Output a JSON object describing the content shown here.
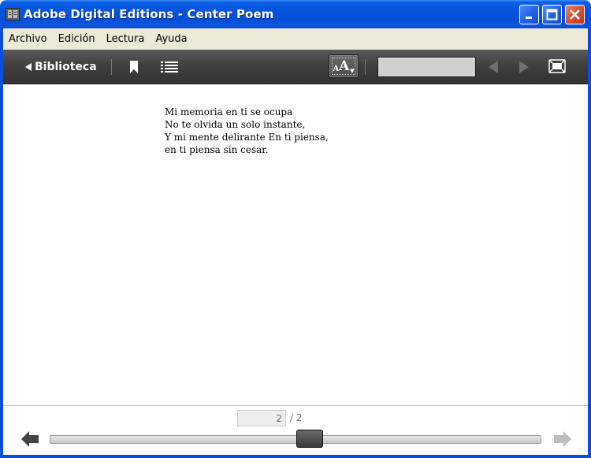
{
  "window": {
    "title": "Adobe Digital Editions - Center Poem"
  },
  "menu": {
    "items": [
      "Archivo",
      "Edición",
      "Lectura",
      "Ayuda"
    ]
  },
  "toolbar": {
    "back_label": "Biblioteca",
    "font_button": {
      "small": "A",
      "big": "A"
    },
    "search_value": ""
  },
  "poem": {
    "lines": [
      "Mi memoria en ti se ocupa",
      "No te olvida un solo instante,",
      "Y mi mente delirante En ti piensa,",
      "en ti piensa sin cesar."
    ]
  },
  "pagination": {
    "current": "2",
    "total_label": "/ 2",
    "progress_fraction": 0.53
  },
  "icons": {
    "app": "adobe-digital-editions-icon",
    "bookmark": "bookmark-icon",
    "toc": "list-icon",
    "prev": "triangle-left-icon",
    "next": "triangle-right-icon",
    "fullscreen": "fullscreen-icon",
    "page_back": "arrow-left-icon",
    "page_forward": "arrow-right-icon"
  },
  "colors": {
    "titlebar": "#0654dc",
    "toolbar": "#3e3e3e",
    "menubar": "#ece9d8"
  }
}
